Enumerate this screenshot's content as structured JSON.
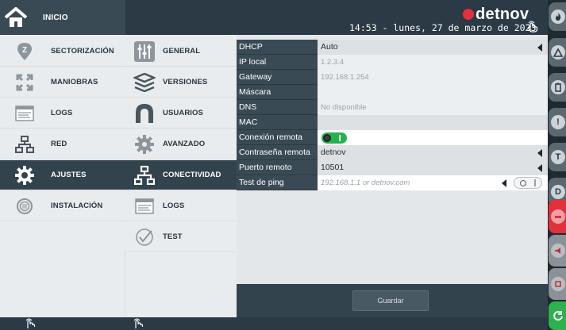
{
  "header": {
    "home_label": "INICIO",
    "brand_name": "detnov",
    "datetime": "14:53  -  lunes, 27 de marzo de 2023"
  },
  "menu": {
    "left": [
      {
        "label": "SECTORIZACIÓN",
        "icon": "zone-icon"
      },
      {
        "label": "MANIOBRAS",
        "icon": "maneuvers-icon"
      },
      {
        "label": "LOGS",
        "icon": "logs-icon"
      },
      {
        "label": "RED",
        "icon": "network-icon"
      },
      {
        "label": "AJUSTES",
        "icon": "gear-icon",
        "active": true
      },
      {
        "label": "INSTALACIÓN",
        "icon": "installation-icon"
      }
    ],
    "right": [
      {
        "label": "GENERAL",
        "icon": "sliders-icon"
      },
      {
        "label": "VERSIONES",
        "icon": "layers-icon"
      },
      {
        "label": "USUARIOS",
        "icon": "user-icon"
      },
      {
        "label": "AVANZADO",
        "icon": "advanced-gear-icon"
      },
      {
        "label": "CONECTIVIDAD",
        "icon": "connectivity-icon",
        "active": true
      },
      {
        "label": "LOGS",
        "icon": "logs-icon"
      },
      {
        "label": "TEST",
        "icon": "check-circle-icon"
      }
    ]
  },
  "settings": {
    "dhcp": {
      "label": "DHCP",
      "value": "Auto"
    },
    "ip_local": {
      "label": "IP local",
      "value": "1.2.3.4"
    },
    "gateway": {
      "label": "Gateway",
      "value": "192.168.1.254"
    },
    "mascara": {
      "label": "Máscara",
      "value": ""
    },
    "dns": {
      "label": "DNS",
      "value": "No disponible"
    },
    "mac": {
      "label": "MAC",
      "value": ""
    },
    "remote_connection": {
      "label": "Conexión remota",
      "enabled": true
    },
    "remote_password": {
      "label": "Contraseña remota",
      "value": "detnov"
    },
    "remote_port": {
      "label": "Puerto remoto",
      "value": "10501"
    },
    "ping_test": {
      "label": "Test de ping",
      "placeholder": "192.168.1.1 or detnov.com"
    }
  },
  "actions": {
    "save_label": "Guardar"
  },
  "rail": [
    {
      "icon": "fire-icon",
      "color": "#cdd2d6"
    },
    {
      "icon": "warning-icon",
      "color": "#cdd2d6"
    },
    {
      "icon": "battery-icon",
      "color": "#cdd2d6"
    },
    {
      "icon": "exclamation-icon",
      "color": "#cdd2d6"
    },
    {
      "icon": "test-t-icon",
      "color": "#cdd2d6"
    },
    {
      "icon": "disable-d-icon",
      "color": "#cdd2d6"
    },
    {
      "icon": "siren-icon",
      "color": "#e3303d"
    },
    {
      "icon": "horn-icon",
      "color": "#b9bec2"
    },
    {
      "icon": "device-icon",
      "color": "#b9bec2"
    },
    {
      "icon": "reset-icon",
      "color": "#2fb14e"
    }
  ],
  "colors": {
    "accent_red": "#e3303d",
    "toggle_green": "#22b34c",
    "sidebar_dark": "#33434e"
  }
}
